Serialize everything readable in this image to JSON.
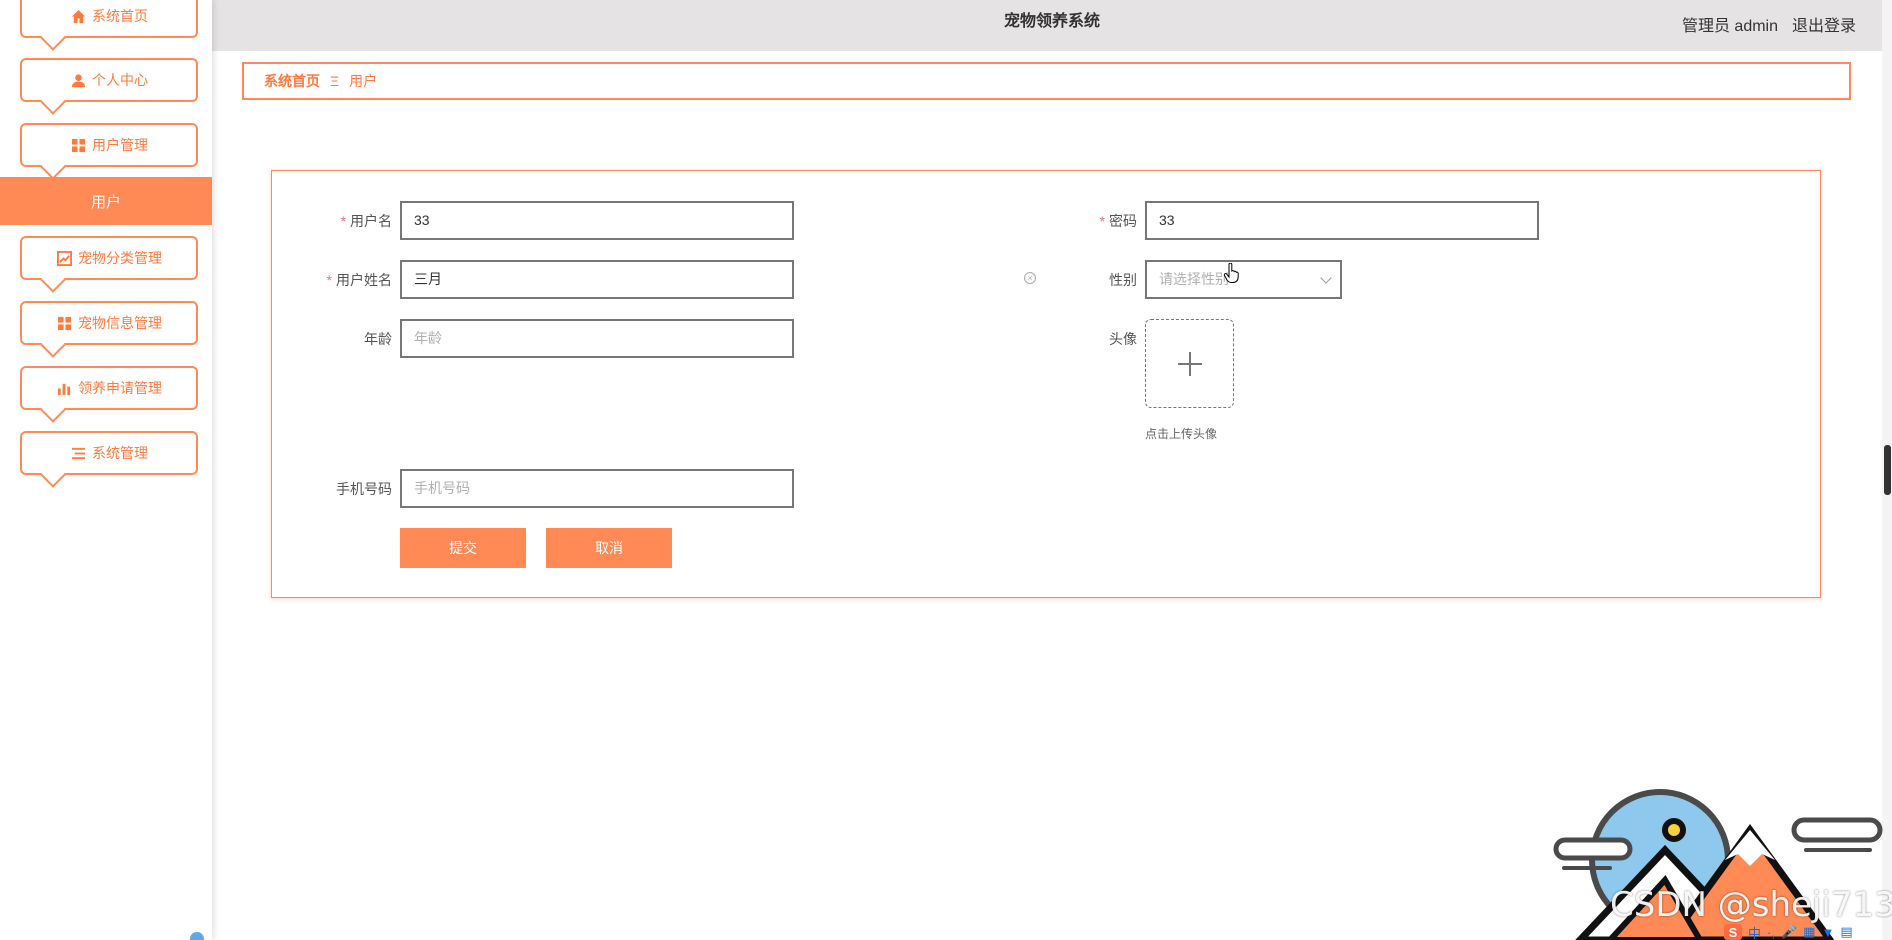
{
  "app": {
    "title": "宠物领养系统"
  },
  "header": {
    "user_label": "管理员 admin",
    "logout_label": "退出登录"
  },
  "sidebar": {
    "items": [
      {
        "label": "系统首页",
        "icon": "home-icon"
      },
      {
        "label": "个人中心",
        "icon": "person-icon"
      },
      {
        "label": "用户管理",
        "icon": "grid-icon"
      },
      {
        "label": "宠物分类管理",
        "icon": "chart-icon"
      },
      {
        "label": "宠物信息管理",
        "icon": "grid-icon"
      },
      {
        "label": "领养申请管理",
        "icon": "bar-chart-icon"
      },
      {
        "label": "系统管理",
        "icon": "list-icon"
      }
    ],
    "active_sub": "用户"
  },
  "breadcrumb": {
    "home": "系统首页",
    "separator": "Ξ",
    "current": "用户"
  },
  "form": {
    "username": {
      "label": "用户名",
      "value": "33",
      "required": true
    },
    "password": {
      "label": "密码",
      "value": "33",
      "required": true
    },
    "realname": {
      "label": "用户姓名",
      "value": "三月",
      "required": true
    },
    "gender": {
      "label": "性别",
      "placeholder": "请选择性别"
    },
    "age": {
      "label": "年龄",
      "placeholder": "年龄"
    },
    "avatar": {
      "label": "头像",
      "hint": "点击上传头像"
    },
    "phone": {
      "label": "手机号码",
      "placeholder": "手机号码"
    },
    "submit_label": "提交",
    "cancel_label": "取消",
    "required_mark": "*"
  },
  "watermark": {
    "text": "CSDN @sheji713"
  },
  "ime": {
    "s": "S",
    "lang": "中"
  },
  "colors": {
    "accent": "#ff8a55",
    "header_bg": "#e6e3e4",
    "required": "#f56c6c"
  }
}
